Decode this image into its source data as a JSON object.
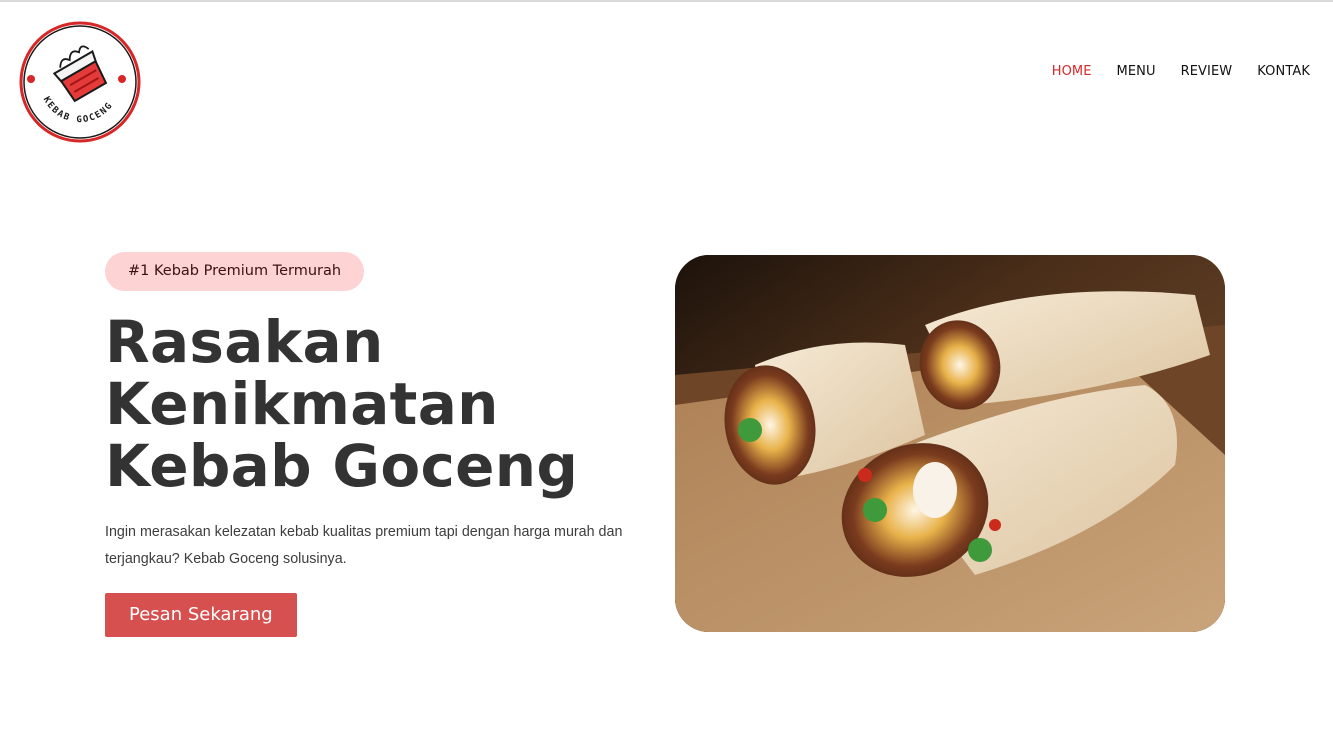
{
  "brand": {
    "name": "KEBAB GOCENG",
    "logo_icon": "kebab-wrap-icon",
    "accent_color": "#d62828"
  },
  "nav": {
    "items": [
      {
        "label": "HOME",
        "active": true
      },
      {
        "label": "MENU",
        "active": false
      },
      {
        "label": "REVIEW",
        "active": false
      },
      {
        "label": "KONTAK",
        "active": false
      }
    ]
  },
  "hero": {
    "badge": "#1 Kebab Premium Termurah",
    "headline_lines": [
      "Rasakan",
      "Kenikmatan",
      "Kebab Goceng"
    ],
    "description": "Ingin merasakan kelezatan kebab kualitas premium tapi dengan harga murah dan terjangkau? Kebab Goceng solusinya.",
    "cta_label": "Pesan Sekarang",
    "cta_color": "#d65050",
    "badge_color": "#fdd3d3",
    "image_subject": "kebab wraps on wooden board"
  }
}
